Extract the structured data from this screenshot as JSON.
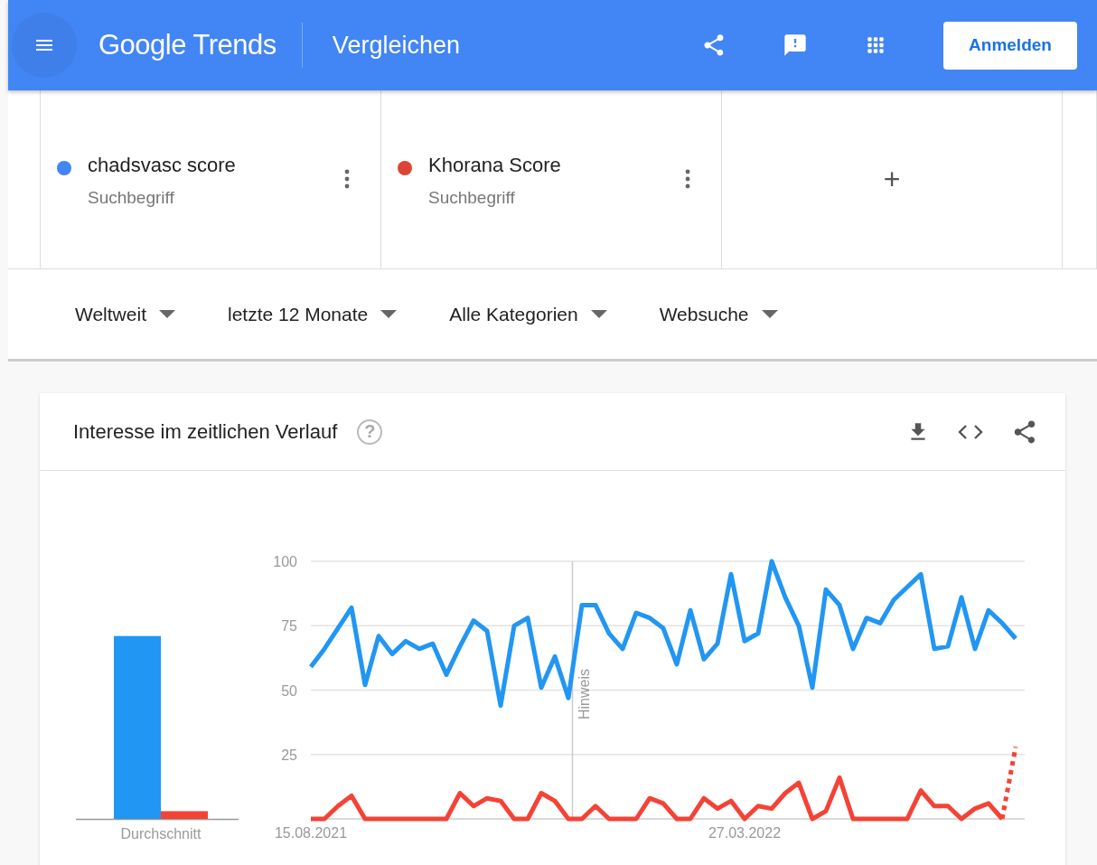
{
  "header": {
    "logo": "Google Trends",
    "title": "Vergleichen",
    "signin": "Anmelden"
  },
  "terms": [
    {
      "name": "chadsvasc score",
      "type": "Suchbegriff",
      "color": "#4285f4"
    },
    {
      "name": "Khorana Score",
      "type": "Suchbegriff",
      "color": "#db4437"
    }
  ],
  "add_term": "+",
  "filters": [
    {
      "label": "Weltweit"
    },
    {
      "label": "letzte 12 Monate"
    },
    {
      "label": "Alle Kategorien"
    },
    {
      "label": "Websuche"
    }
  ],
  "panel": {
    "title": "Interesse im zeitlichen Verlauf",
    "help": "?",
    "average_chart": {
      "chart_data": {
        "type": "bar",
        "categories": [
          "Durchschnitt"
        ],
        "ylim": [
          0,
          100
        ],
        "series": [
          {
            "color": "#2196f3",
            "values": [
              71
            ]
          },
          {
            "color": "#f44336",
            "values": [
              3
            ]
          }
        ]
      }
    },
    "trend_chart": {
      "partial_last_point": [
        false,
        true
      ],
      "chart_data": {
        "type": "line",
        "ylim": [
          0,
          100
        ],
        "yticks": [
          25,
          50,
          75,
          100
        ],
        "grid": true,
        "categories": [
          "15.08.2021",
          null,
          null,
          null,
          null,
          null,
          null,
          null,
          null,
          null,
          null,
          null,
          null,
          null,
          null,
          null,
          null,
          null,
          null,
          null,
          null,
          null,
          null,
          null,
          null,
          null,
          null,
          null,
          null,
          null,
          null,
          null,
          "27.03.2022",
          null,
          null,
          null,
          null,
          null,
          null,
          null,
          null,
          null,
          null,
          null,
          null,
          null,
          null,
          null,
          null,
          null,
          null,
          null,
          null
        ],
        "annotations": [
          "Hinweis"
        ],
        "series": [
          {
            "color": "#2196f3",
            "values": [
              59,
              66,
              74,
              82,
              52,
              71,
              64,
              69,
              66,
              68,
              56,
              67,
              77,
              73,
              44,
              75,
              78,
              51,
              63,
              47,
              83,
              83,
              72,
              66,
              80,
              78,
              74,
              60,
              81,
              62,
              68,
              95,
              69,
              72,
              100,
              86,
              75,
              51,
              89,
              83,
              66,
              78,
              76,
              85,
              90,
              95,
              66,
              67,
              86,
              66,
              81,
              76,
              70
            ]
          },
          {
            "color": "#f44336",
            "values": [
              0,
              0,
              5,
              9,
              0,
              0,
              0,
              0,
              0,
              0,
              0,
              10,
              5,
              8,
              7,
              0,
              0,
              10,
              7,
              0,
              0,
              5,
              0,
              0,
              0,
              8,
              6,
              0,
              0,
              8,
              4,
              7,
              0,
              5,
              4,
              10,
              14,
              0,
              3,
              16,
              0,
              0,
              0,
              0,
              0,
              11,
              5,
              5,
              0,
              4,
              6,
              0,
              28
            ]
          }
        ]
      }
    }
  }
}
